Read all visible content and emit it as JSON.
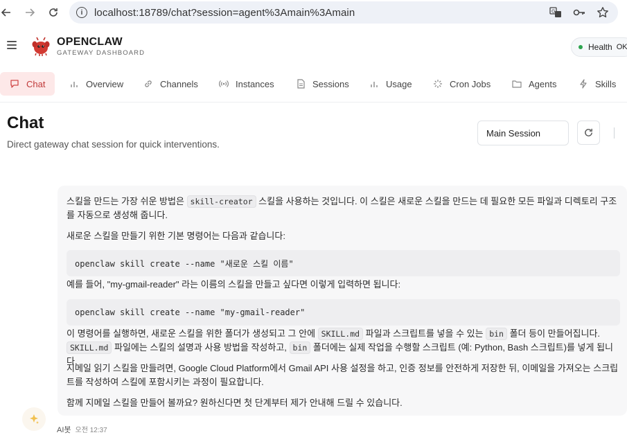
{
  "browser": {
    "url": "localhost:18789/chat?session=agent%3Amain%3Amain"
  },
  "header": {
    "brand": "OPENCLAW",
    "subtitle": "GATEWAY DASHBOARD",
    "health_label": "Health",
    "health_value": "OK"
  },
  "tabs": [
    {
      "label": "Chat",
      "icon": "chat-bubble-icon"
    },
    {
      "label": "Overview",
      "icon": "bar-chart-icon"
    },
    {
      "label": "Channels",
      "icon": "link-icon"
    },
    {
      "label": "Instances",
      "icon": "broadcast-icon"
    },
    {
      "label": "Sessions",
      "icon": "document-icon"
    },
    {
      "label": "Usage",
      "icon": "bar-chart-icon"
    },
    {
      "label": "Cron Jobs",
      "icon": "loader-icon"
    },
    {
      "label": "Agents",
      "icon": "folder-icon"
    },
    {
      "label": "Skills",
      "icon": "lightning-icon"
    }
  ],
  "page": {
    "title": "Chat",
    "subtitle": "Direct gateway chat session for quick interventions.",
    "session_selected": "Main Session"
  },
  "message": {
    "p1_a": "스킬을 만드는 가장 쉬운 방법은 ",
    "p1_code": "skill-creator",
    "p1_b": " 스킬을 사용하는 것입니다. 이 스킬은 새로운 스킬을 만드는 데 필요한 모든 파일과 디렉토리 구조를 자동으로 생성해 줍니다.",
    "p2": "새로운 스킬을 만들기 위한 기본 명령어는 다음과 같습니다:",
    "code1": "openclaw skill create --name \"새로운 스킬 이름\"",
    "p3": "예를 들어, \"my-gmail-reader\" 라는 이름의 스킬을 만들고 싶다면 이렇게 입력하면 됩니다:",
    "code2": "openclaw skill create --name \"my-gmail-reader\"",
    "p4_a": "이 명령어를 실행하면, 새로운 스킬을 위한 폴더가 생성되고 그 안에 ",
    "p4_code1": "SKILL.md",
    "p4_b": " 파일과 스크립트를 넣을 수 있는 ",
    "p4_code2": "bin",
    "p4_c": " 폴더 등이 만들어집니다. ",
    "p4_code3": "SKILL.md",
    "p4_d": " 파일에는 스킬의 설명과 사용 방법을 작성하고, ",
    "p4_code4": "bin",
    "p4_e": " 폴더에는 실제 작업을 수행할 스크립트 (예: Python, Bash 스크립트)를 넣게 됩니다.",
    "p5": "지메일 읽기 스킬을 만들려면, Google Cloud Platform에서 Gmail API 사용 설정을 하고, 인증 정보를 안전하게 저장한 뒤, 이메일을 가져오는 스크립트를 작성하여 스킬에 포함시키는 과정이 필요합니다.",
    "p6": "함께 지메일 스킬을 만들어 볼까요? 원하신다면 첫 단계부터 제가 안내해 드릴 수 있습니다.",
    "sender": "AI봇",
    "time": "오전 12:37"
  },
  "colors": {
    "accent": "#c03a3a",
    "accent_bg": "#fde8e8",
    "health_dot": "#2da44e"
  }
}
